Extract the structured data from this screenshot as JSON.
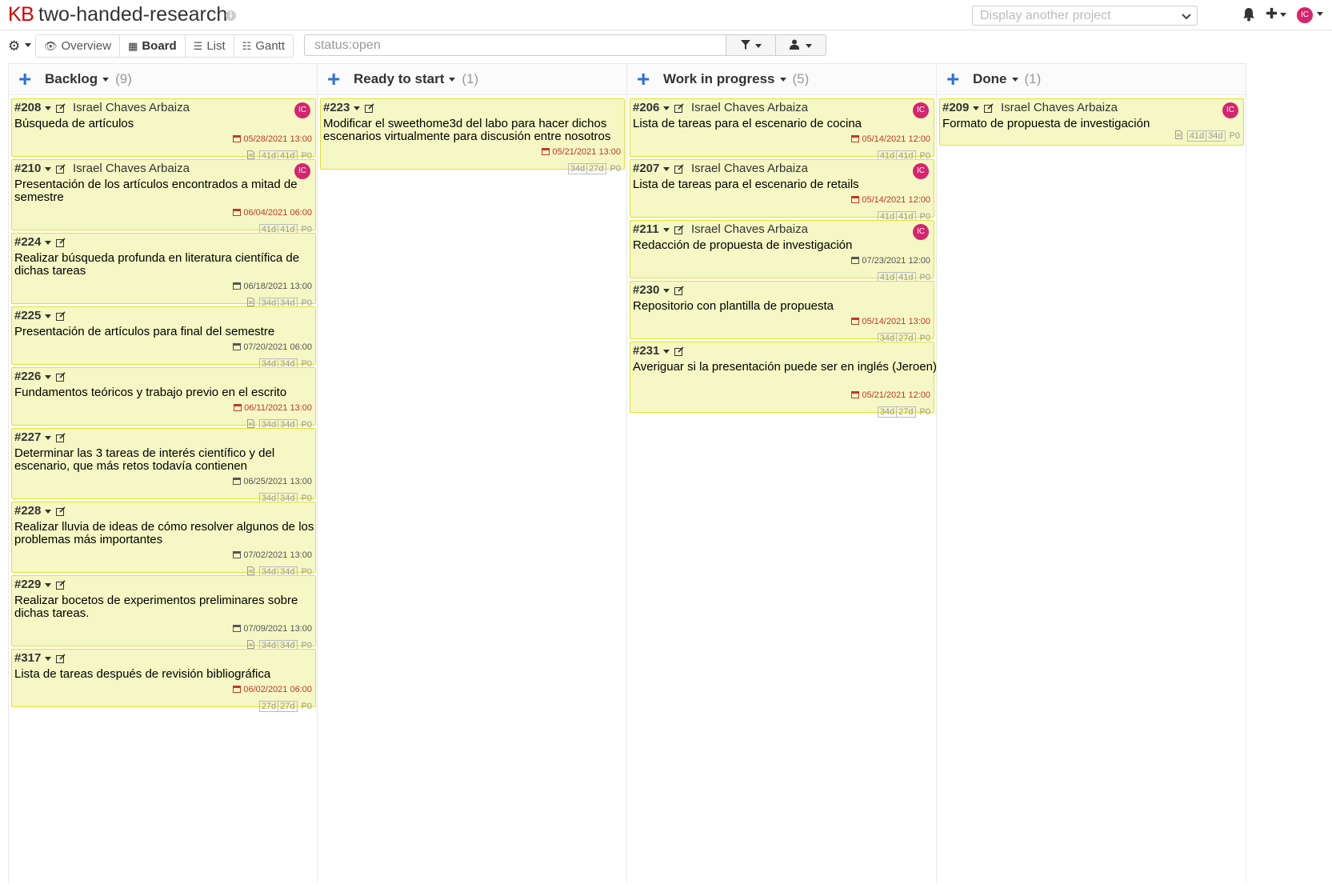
{
  "header": {
    "logo": "KB",
    "project_title": "two-handed-research",
    "info_icon_glyph": "i",
    "project_select_placeholder": "Display another project",
    "user_initials": "IC"
  },
  "toolbar": {
    "views": [
      {
        "label": "Overview",
        "icon": "eye-icon"
      },
      {
        "label": "Board",
        "icon": "board-icon",
        "active": true
      },
      {
        "label": "List",
        "icon": "list-icon"
      },
      {
        "label": "Gantt",
        "icon": "sliders-icon"
      }
    ],
    "filter_value": "status:open",
    "filter_icon": "funnel-icon",
    "user_filter_icon": "user-icon"
  },
  "colors": {
    "accent": "#3071d6",
    "card_bg": "#f5f7c4",
    "card_border": "#dfe32d",
    "avatar": "#d6246f",
    "overdue": "#c0392b"
  },
  "columns": [
    {
      "title": "Backlog",
      "count": "(9)",
      "tasks": [
        {
          "id": "#208",
          "assignee": "Israel Chaves Arbaiza",
          "avatar": "IC",
          "title": "Búsqueda de artículos",
          "due": "05/28/2021 13:00",
          "overdue": true,
          "doc": true,
          "est1": "41d",
          "est2": "41d",
          "priority": "P0"
        },
        {
          "id": "#210",
          "assignee": "Israel Chaves Arbaiza",
          "avatar": "IC",
          "title": "Presentación de los artículos encontrados a mitad de semestre",
          "due": "06/04/2021 06:00",
          "overdue": true,
          "doc": false,
          "est1": "41d",
          "est2": "41d",
          "priority": "P0"
        },
        {
          "id": "#224",
          "assignee": "",
          "avatar": "",
          "title": "Realizar búsqueda profunda en literatura científica de dichas tareas",
          "due": "06/18/2021 13:00",
          "overdue": false,
          "doc": true,
          "est1": "34d",
          "est2": "34d",
          "priority": "P0"
        },
        {
          "id": "#225",
          "assignee": "",
          "avatar": "",
          "title": "Presentación de artículos para final del semestre",
          "due": "07/20/2021 06:00",
          "overdue": false,
          "doc": false,
          "est1": "34d",
          "est2": "34d",
          "priority": "P0"
        },
        {
          "id": "#226",
          "assignee": "",
          "avatar": "",
          "title": "Fundamentos teóricos y trabajo previo en el escrito",
          "due": "06/11/2021 13:00",
          "overdue": true,
          "doc": true,
          "est1": "34d",
          "est2": "34d",
          "priority": "P0"
        },
        {
          "id": "#227",
          "assignee": "",
          "avatar": "",
          "title": "Determinar las 3 tareas de interés científico y del escenario, que más retos todavía contienen",
          "due": "06/25/2021 13:00",
          "overdue": false,
          "doc": false,
          "est1": "34d",
          "est2": "34d",
          "priority": "P0"
        },
        {
          "id": "#228",
          "assignee": "",
          "avatar": "",
          "title": "Realizar lluvia de ideas de cómo resolver algunos de los problemas más importantes",
          "due": "07/02/2021 13:00",
          "overdue": false,
          "doc": true,
          "est1": "34d",
          "est2": "34d",
          "priority": "P0"
        },
        {
          "id": "#229",
          "assignee": "",
          "avatar": "",
          "title": "Realizar bocetos de experimentos preliminares sobre dichas tareas.",
          "due": "07/09/2021 13:00",
          "overdue": false,
          "doc": true,
          "est1": "34d",
          "est2": "34d",
          "priority": "P0"
        },
        {
          "id": "#317",
          "assignee": "",
          "avatar": "",
          "title": "Lista de tareas después de revisión bibliográfica",
          "due": "06/02/2021 06:00",
          "overdue": true,
          "doc": false,
          "est1": "27d",
          "est2": "27d",
          "priority": "P0"
        }
      ]
    },
    {
      "title": "Ready to start",
      "count": "(1)",
      "tasks": [
        {
          "id": "#223",
          "assignee": "",
          "avatar": "",
          "title": "Modificar el sweethome3d del labo para hacer dichos escenarios virtualmente para discusión entre nosotros",
          "due": "05/21/2021 13:00",
          "overdue": true,
          "doc": false,
          "est1": "34d",
          "est2": "27d",
          "priority": "P0"
        }
      ]
    },
    {
      "title": "Work in progress",
      "count": "(5)",
      "tasks": [
        {
          "id": "#206",
          "assignee": "Israel Chaves Arbaiza",
          "avatar": "IC",
          "title": "Lista de tareas para el escenario de cocina",
          "due": "05/14/2021 12:00",
          "overdue": true,
          "doc": false,
          "est1": "41d",
          "est2": "41d",
          "priority": "P0"
        },
        {
          "id": "#207",
          "assignee": "Israel Chaves Arbaiza",
          "avatar": "IC",
          "title": "Lista de tareas para el escenario de retails",
          "due": "05/14/2021 12:00",
          "overdue": true,
          "doc": false,
          "est1": "41d",
          "est2": "41d",
          "priority": "P0"
        },
        {
          "id": "#211",
          "assignee": "Israel Chaves Arbaiza",
          "avatar": "IC",
          "title": "Redacción de propuesta de investigación",
          "due": "07/23/2021 12:00",
          "overdue": false,
          "doc": false,
          "est1": "41d",
          "est2": "41d",
          "priority": "P0"
        },
        {
          "id": "#230",
          "assignee": "",
          "avatar": "",
          "title": "Repositorio con plantilla de propuesta",
          "due": "05/14/2021 13:00",
          "overdue": true,
          "doc": false,
          "est1": "34d",
          "est2": "27d",
          "priority": "P0"
        },
        {
          "id": "#231",
          "assignee": "",
          "avatar": "",
          "title": "Averiguar si la presentación puede ser en inglés (Jeroen)",
          "due": "05/21/2021 12:00",
          "overdue": true,
          "doc": false,
          "est1": "34d",
          "est2": "27d",
          "priority": "P0"
        }
      ]
    },
    {
      "title": "Done",
      "count": "(1)",
      "tasks": [
        {
          "id": "#209",
          "assignee": "Israel Chaves Arbaiza",
          "avatar": "IC",
          "title": "Formato de propuesta de investigación",
          "due": "",
          "overdue": false,
          "doc": true,
          "est1": "41d",
          "est2": "34d",
          "priority": "P0"
        }
      ]
    }
  ]
}
